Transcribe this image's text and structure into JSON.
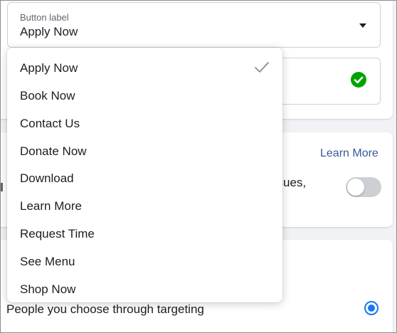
{
  "button_select": {
    "label": "Button label",
    "value": "Apply Now"
  },
  "dropdown": {
    "options": [
      {
        "label": "Apply Now",
        "selected": true
      },
      {
        "label": "Book Now",
        "selected": false
      },
      {
        "label": "Contact Us",
        "selected": false
      },
      {
        "label": "Donate Now",
        "selected": false
      },
      {
        "label": "Download",
        "selected": false
      },
      {
        "label": "Learn More",
        "selected": false
      },
      {
        "label": "Request Time",
        "selected": false
      },
      {
        "label": "See Menu",
        "selected": false
      },
      {
        "label": "Shop Now",
        "selected": false
      }
    ]
  },
  "middle_section": {
    "link_label": "Learn More",
    "partial_text": "ssues,",
    "toggle_on": false
  },
  "audience": {
    "option_label": "People you choose through targeting",
    "selected": true
  },
  "colors": {
    "accent": "#1877f2",
    "link": "#385898",
    "success": "#00a400"
  }
}
